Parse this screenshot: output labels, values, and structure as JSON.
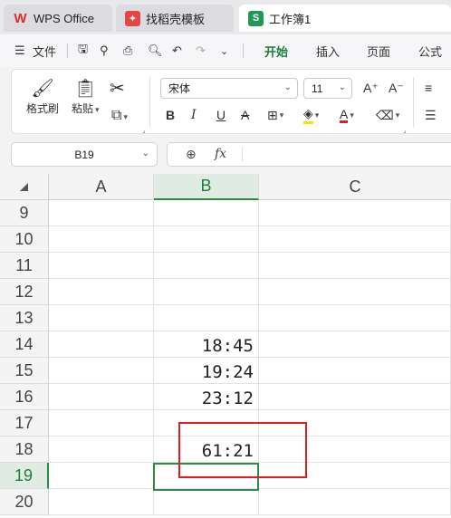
{
  "tabs": [
    {
      "label": "WPS Office",
      "icon": "wps-logo-icon"
    },
    {
      "label": "找稻壳模板",
      "icon": "template-icon"
    },
    {
      "label": "工作簿1",
      "icon": "spreadsheet-icon",
      "badge": "S"
    }
  ],
  "menu": {
    "file": "文件",
    "items": [
      "开始",
      "插入",
      "页面",
      "公式"
    ],
    "active": "开始"
  },
  "ribbon": {
    "format_painter": "格式刷",
    "paste": "粘贴",
    "font_name": "宋体",
    "font_size": "11",
    "bold": "B",
    "italic": "I",
    "underline": "U",
    "strike": "A",
    "font_color_letter": "A",
    "grow": "A⁺",
    "shrink": "A⁻"
  },
  "formula_bar": {
    "name_box": "B19",
    "fx": "fx",
    "content": ""
  },
  "sheet": {
    "columns": [
      "A",
      "B",
      "C"
    ],
    "selected_column": "B",
    "rows": [
      "9",
      "10",
      "11",
      "12",
      "13",
      "14",
      "15",
      "16",
      "17",
      "18",
      "19",
      "20"
    ],
    "selected_row": "19",
    "cells": {
      "B14": "18:45",
      "B15": "19:24",
      "B16": "23:12",
      "B18": "61:21"
    }
  },
  "colors": {
    "accent": "#1a7f3b",
    "selection": "#2f8a45",
    "annotation": "#e01e1e"
  }
}
